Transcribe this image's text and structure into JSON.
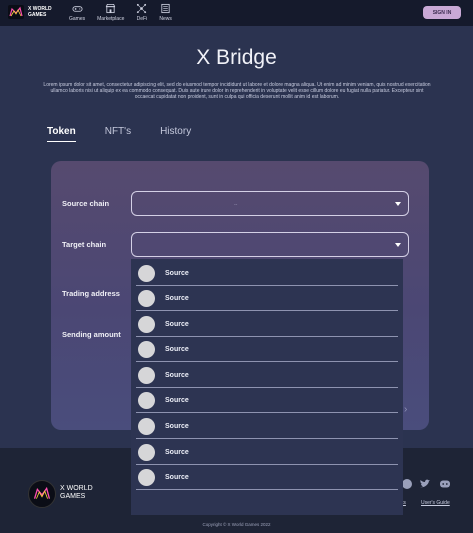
{
  "brand": {
    "logo_line1": "X WORLD",
    "logo_line2": "GAMES"
  },
  "nav": [
    {
      "label": "Games",
      "icon": "gamepad-icon"
    },
    {
      "label": "Marketplace",
      "icon": "store-icon"
    },
    {
      "label": "DeFi",
      "icon": "network-icon"
    },
    {
      "label": "News",
      "icon": "news-icon"
    }
  ],
  "header": {
    "signin_label": "SIGN IN"
  },
  "hero": {
    "title": "X Bridge",
    "description": "Lorem ipsum dolor sit amet, consectetur adipiscing elit, sed do eiusmod tempor incididunt ut labore et dolore magna aliqua. Ut enim ad minim veniam, quis nostrud exercitation ullamco laboris nisi ut aliquip ex ea commodo consequat. Duis aute irure dolor in reprehenderit in voluptate velit esse cillum dolore eu fugiat nulla pariatur. Excepteur sint occaecat cupidatat non proident, sunt in culpa qui officia deserunt mollit anim id est laborum."
  },
  "tabs": [
    {
      "label": "Token",
      "active": true
    },
    {
      "label": "NFT's",
      "active": false
    },
    {
      "label": "History",
      "active": false
    }
  ],
  "form": {
    "source_chain_label": "Source chain",
    "source_chain_value": "--",
    "target_chain_label": "Target chain",
    "trading_address_label": "Trading address",
    "sending_amount_label": "Sending amount"
  },
  "dropdown": {
    "options": [
      "Source",
      "Source",
      "Source",
      "Source",
      "Source",
      "Source",
      "Source",
      "Source",
      "Source"
    ]
  },
  "footer": {
    "logo_line1": "X WORLD",
    "logo_line2": "GAMES",
    "link_partial": "ts",
    "users_guide": "User's Guide",
    "copyright": "Copyright © X World Games 2022"
  },
  "colors": {
    "background": "#2b3350",
    "header": "#151a2c",
    "signin": "#c9a9d6",
    "card_top": "#564a6f",
    "dropdown": "#2d3452"
  }
}
